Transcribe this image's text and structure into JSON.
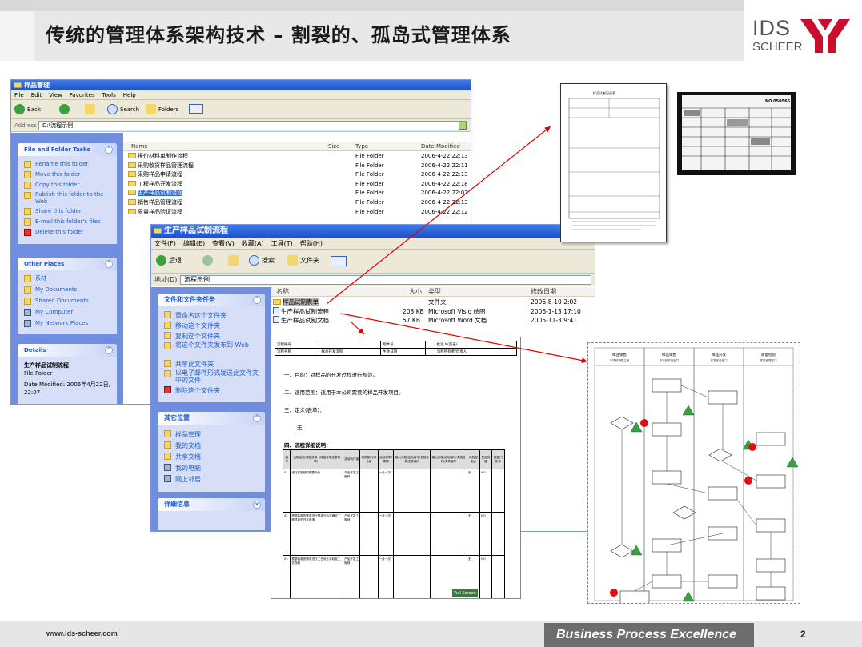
{
  "slide": {
    "title": "传统的管理体系架构技术 – 割裂的、孤岛式管理体系",
    "logo_top": "IDS",
    "logo_bottom": "SCHEER",
    "footer_url": "www.ids-scheer.com",
    "footer_tagline": "Business Process Excellence",
    "page_number": "2",
    "colors": {
      "logo_red": "#c8102e",
      "arrow_red": "#e00000",
      "xp_blue": "#215dc6"
    }
  },
  "win1": {
    "title": "样品管理",
    "menu": [
      "File",
      "Edit",
      "View",
      "Favorites",
      "Tools",
      "Help"
    ],
    "toolbar": {
      "back": "Back",
      "search": "Search",
      "folders": "Folders"
    },
    "address_label": "Address",
    "address_value": "D:\\流程示例",
    "tasks": {
      "header": "File and Folder Tasks",
      "items": [
        "Rename this folder",
        "Move this folder",
        "Copy this folder",
        "Publish this folder to the Web",
        "Share this folder",
        "E-mail this folder's files",
        "Delete this folder"
      ]
    },
    "other_places": {
      "header": "Other Places",
      "items": [
        "系材",
        "My Documents",
        "Shared Documents",
        "My Computer",
        "My Network Places"
      ]
    },
    "details": {
      "header": "Details",
      "name": "生产样品试制流程",
      "type": "File Folder",
      "modified": "Date Modified: 2006年4月22日, 22:07"
    },
    "columns": [
      "Name",
      "Size",
      "Type",
      "Date Modified"
    ],
    "files": [
      {
        "name": "报价材料单制作流程",
        "type": "File Folder",
        "date": "2006-4-22 22:13"
      },
      {
        "name": "采购收货样品管理流程",
        "type": "File Folder",
        "date": "2006-4-22 22:11"
      },
      {
        "name": "采购样品申请流程",
        "type": "File Folder",
        "date": "2006-4-22 22:13"
      },
      {
        "name": "工程样品开发流程",
        "type": "File Folder",
        "date": "2006-4-22 22:18"
      },
      {
        "name": "生产样品试制流程",
        "type": "File Folder",
        "date": "2006-4-22 22:07"
      },
      {
        "name": "销售样品管理流程",
        "type": "File Folder",
        "date": "2006-4-22 22:13"
      },
      {
        "name": "质量样品验证流程",
        "type": "File Folder",
        "date": "2006-4-22 22:12"
      }
    ]
  },
  "win2": {
    "title": "生产样品试制流程",
    "menu": [
      "文件(F)",
      "编辑(E)",
      "查看(V)",
      "收藏(A)",
      "工具(T)",
      "帮助(H)"
    ],
    "toolbar": {
      "back": "后退",
      "search": "搜索",
      "folders": "文件夹"
    },
    "address_label": "地址(D)",
    "address_value": "流程示例",
    "tasks": {
      "header": "文件和文件夹任务",
      "items": [
        "重命名这个文件夹",
        "移动这个文件夹",
        "复制这个文件夹",
        "将这个文件夹发布到 Web",
        "共享此文件夹",
        "以电子邮件形式发送此文件夹中的文件",
        "删除这个文件夹"
      ]
    },
    "other_places": {
      "header": "其它位置",
      "items": [
        "样品管理",
        "我的文档",
        "共享文档",
        "我的电脑",
        "网上邻居"
      ]
    },
    "details_header": "详细信息",
    "columns": [
      "名称",
      "大小",
      "类型",
      "修改日期"
    ],
    "files": [
      {
        "name": "样品试制表单",
        "size": "",
        "type": "文件夹",
        "date": "2006-8-10 2:02"
      },
      {
        "name": "生产样品试制流程",
        "size": "203 KB",
        "type": "Microsoft Visio 绘图",
        "date": "2006-1-13 17:10"
      },
      {
        "name": "生产样品试制文档",
        "size": "57 KB",
        "type": "Microsoft Word 文档",
        "date": "2005-11-3 9:41"
      }
    ]
  },
  "doc": {
    "header_cells": [
      "流程编号",
      "",
      "版本号",
      "",
      "批准人(签名)",
      "流程名称",
      "样品开发流程",
      "生效日期",
      "",
      "流程所有者/负责人"
    ],
    "sections": [
      "一、目的：对样品的开发过程进行规范。",
      "二、适用范围：适用于本公司需要的样品开发项目。",
      "三、定义(表单)：",
      "无",
      "四、流程详细说明："
    ],
    "table_headers": [
      "编号",
      "流程活动/流程说明（详细说明注意事项）",
      "活动执行者",
      "相关部门/参与者",
      "活动频率/周期",
      "输入流程/活动编号/文档名称/文件编号",
      "输出流程/活动编号/文档名称/文件编号",
      "风险控制点",
      "是否关键",
      "跨部门协作"
    ],
    "table_rows": [
      {
        "no": "01",
        "desc": "进行客服部的需要分析",
        "dept": "产品开发工程师",
        "freq": "一月一次",
        "ctl": "无",
        "key": "NO"
      },
      {
        "no": "02",
        "desc": "根据客服的需求进行需求分析并确定工程项目的开发申请",
        "dept": "产品开发工程师",
        "freq": "一月一次",
        "ctl": "无",
        "key": "NO"
      },
      {
        "no": "03",
        "desc": "根据客服的需求进行工艺设计并制定工艺流程",
        "dept": "产品开发工程师",
        "freq": "一月一次",
        "ctl": "无",
        "key": "NO"
      }
    ],
    "zoom": "Full Screen"
  },
  "flow": {
    "lanes": [
      "样品销售",
      "样品销售",
      "样品开发",
      "质量检验"
    ],
    "lane_subs": [
      "市场部销售主管",
      "市场部样品部门",
      "开发部各部门",
      "质量管理部门"
    ],
    "start_label": "开始",
    "end_label": "结束"
  },
  "form_scan": {
    "title": "样品试制记录表",
    "number": "NO 050566"
  }
}
